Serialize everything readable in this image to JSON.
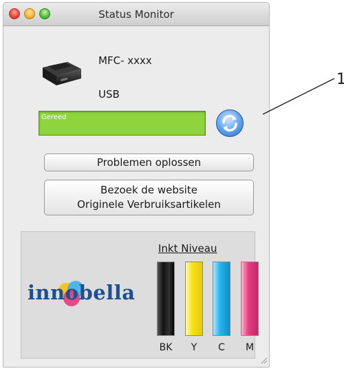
{
  "window": {
    "title": "Status Monitor"
  },
  "device": {
    "model": "MFC- xxxx",
    "connection": "USB"
  },
  "status": {
    "text": "Gereed",
    "color": "#8ed43c"
  },
  "buttons": {
    "troubleshoot": "Problemen oplossen",
    "website_line1": "Bezoek de website",
    "website_line2": "Originele Verbruiksartikelen"
  },
  "ink": {
    "heading": "Inkt Niveau",
    "logo": "innobella",
    "cartridges": [
      {
        "label": "BK",
        "color": "#1a1a1a"
      },
      {
        "label": "Y",
        "color": "#f7e11a"
      },
      {
        "label": "C",
        "color": "#26b5ea"
      },
      {
        "label": "M",
        "color": "#e8407f"
      }
    ]
  },
  "callout": {
    "number": "1"
  }
}
